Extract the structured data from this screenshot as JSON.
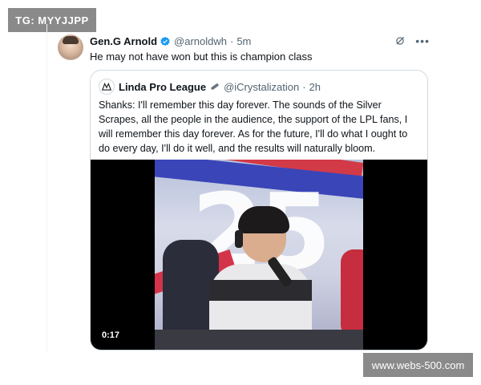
{
  "watermarks": {
    "top_left": "TG: MYYJJPP",
    "bottom_right": "www.webs-500.com"
  },
  "tweet": {
    "author_name": "Gen.G Arnold",
    "handle": "@arnoldwh",
    "separator": "·",
    "time": "5m",
    "text": "He may not have won but this is champion class",
    "verified_color": "#1d9bf0",
    "icons": [
      "grok-icon",
      "more-icon"
    ]
  },
  "quote": {
    "author_name": "Linda Pro League",
    "handle": "@iCrystalization",
    "separator": "·",
    "time": "2h",
    "text": "Shanks: I'll remember this day forever. The sounds of the Silver Scrapes, all the people in the audience, the support of the LPL fans, I will remember this day forever. As for the future, I'll do what I ought to do every day, I'll do it well, and the results will naturally bloom.",
    "video": {
      "timestamp": "0:17",
      "backdrop_number": "25"
    }
  }
}
